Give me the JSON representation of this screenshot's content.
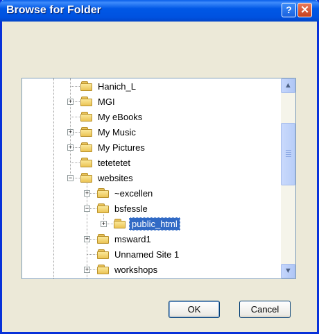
{
  "titlebar": {
    "title": "Browse for Folder",
    "help_label": "?",
    "close_label": "✕"
  },
  "tree": {
    "items": [
      {
        "label": "Hanich_L",
        "expander": ""
      },
      {
        "label": "MGI",
        "expander": "+"
      },
      {
        "label": "My eBooks",
        "expander": ""
      },
      {
        "label": "My Music",
        "expander": "+"
      },
      {
        "label": "My Pictures",
        "expander": "+"
      },
      {
        "label": "tetetetet",
        "expander": ""
      },
      {
        "label": "websites",
        "expander": "−"
      },
      {
        "label": "~excellen",
        "expander": "+"
      },
      {
        "label": "bsfessle",
        "expander": "−"
      },
      {
        "label": "public_html",
        "expander": "+",
        "selected": true
      },
      {
        "label": "msward1",
        "expander": "+"
      },
      {
        "label": "Unnamed Site 1",
        "expander": ""
      },
      {
        "label": "workshops",
        "expander": "+"
      }
    ]
  },
  "scrollbar": {
    "up_arrow": "▲",
    "down_arrow": "▼"
  },
  "buttons": {
    "ok_label": "OK",
    "cancel_label": "Cancel"
  },
  "colors": {
    "titlebar": "#0058E6",
    "selection": "#316AC5",
    "dialog_bg": "#ECE9D8"
  }
}
